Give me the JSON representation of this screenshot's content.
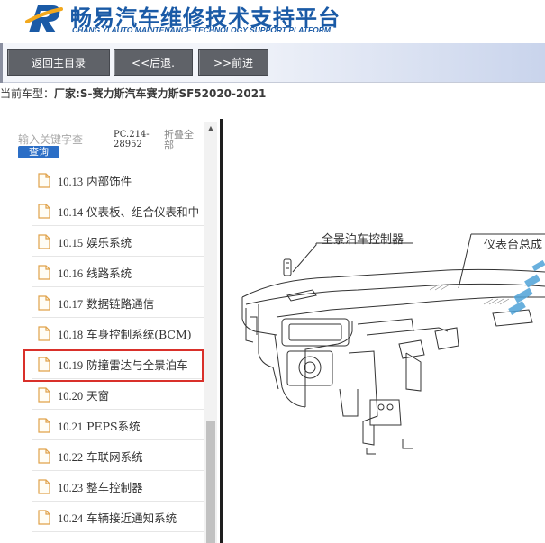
{
  "header": {
    "title_cn": "畅易汽车维修技术支持平台",
    "title_en": "CHANG YI AUTO MAINTENANCE TECHNOLOGY SUPPORT PLATFORM"
  },
  "toolbar": {
    "home_label": "返回主目录",
    "back_label": "<<后退.",
    "forward_label": ">>前进"
  },
  "car_model": {
    "prefix": "当前车型：",
    "value": "厂家:S-赛力斯汽车赛力斯SF52020-2021"
  },
  "sidebar": {
    "search_placeholder": "输入关键字查",
    "search_button": "查询",
    "pc_code": "PC.214-28952",
    "collapse_all": "折叠全部",
    "items": [
      {
        "num": "10.13",
        "label": "内部饰件"
      },
      {
        "num": "10.14",
        "label": "仪表板、组合仪表和中"
      },
      {
        "num": "10.15",
        "label": "娱乐系统"
      },
      {
        "num": "10.16",
        "label": "线路系统"
      },
      {
        "num": "10.17",
        "label": "数据链路通信"
      },
      {
        "num": "10.18",
        "label": "车身控制系统(BCM)"
      },
      {
        "num": "10.19",
        "label": "防撞雷达与全景泊车"
      },
      {
        "num": "10.20",
        "label": "天窗"
      },
      {
        "num": "10.21",
        "label": "PEPS系统"
      },
      {
        "num": "10.22",
        "label": "车联网系统"
      },
      {
        "num": "10.23",
        "label": "整车控制器"
      },
      {
        "num": "10.24",
        "label": "车辆接近通知系统"
      }
    ],
    "selected_index": 6
  },
  "diagram": {
    "label_controller": "全景泊车控制器",
    "label_dashboard": "仪表台总成"
  },
  "colors": {
    "brand_blue": "#1a5aa6",
    "button_gray": "#5f6268",
    "highlight_red": "#d9302a"
  }
}
